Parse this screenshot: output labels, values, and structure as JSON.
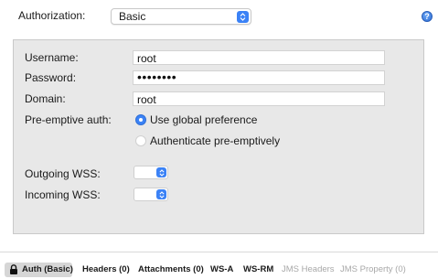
{
  "authorization": {
    "label": "Authorization:",
    "selected": "Basic",
    "help_icon": "question-mark-icon"
  },
  "form": {
    "username_label": "Username:",
    "username_value": "root",
    "password_label": "Password:",
    "password_masked": "••••••••",
    "domain_label": "Domain:",
    "domain_value": "root",
    "preemptive_label": "Pre-emptive auth:",
    "preemptive_options": [
      "Use global preference",
      "Authenticate pre-emptively"
    ],
    "preemptive_selected": "Use global preference",
    "outgoing_wss_label": "Outgoing WSS:",
    "outgoing_wss_value": "",
    "incoming_wss_label": "Incoming WSS:",
    "incoming_wss_value": ""
  },
  "tabs": [
    {
      "label": "Auth (Basic)",
      "active": true,
      "icon": "lock-icon"
    },
    {
      "label": "Headers (0)"
    },
    {
      "label": "Attachments (0)"
    },
    {
      "label": "WS-A"
    },
    {
      "label": "WS-RM"
    },
    {
      "label": "JMS Headers",
      "disabled": true
    },
    {
      "label": "JMS Property (0)",
      "disabled": true
    }
  ],
  "colors": {
    "accent": "#3b82f6",
    "panel_bg": "#e8e8e8",
    "active_tab_bg": "#d6d6d6",
    "disabled_text": "#a8a8a8"
  }
}
